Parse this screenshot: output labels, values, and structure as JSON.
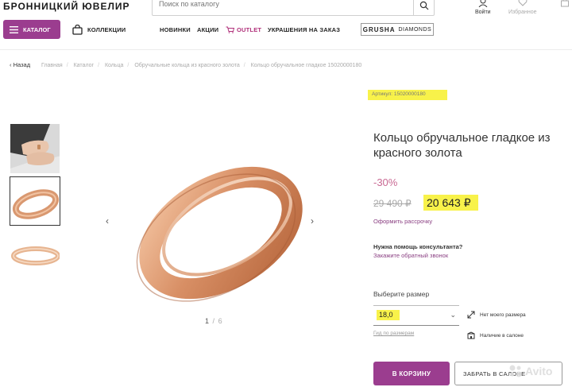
{
  "header": {
    "logo": "БРОННИЦКИЙ ЮВЕЛИР",
    "search_placeholder": "Поиск по каталогу",
    "login_label": "Войти",
    "favorites_label": "Избранное"
  },
  "nav": {
    "catalog": "КАТАЛОГ",
    "collections": "КОЛЛЕКЦИИ",
    "items": [
      "НОВИНКИ",
      "АКЦИИ",
      "OUTLET",
      "УКРАШЕНИЯ НА ЗАКАЗ"
    ],
    "grusha_brand": "GRUSHA",
    "grusha_sub": "DIAMONDS"
  },
  "breadcrumbs": {
    "back": "Назад",
    "items": [
      "Главная",
      "Каталог",
      "Кольца",
      "Обручальные кольца из красного золота",
      "Кольцо обручальное гладкое 15020000180"
    ]
  },
  "gallery": {
    "current": "1",
    "separator": "/",
    "total": "6"
  },
  "product": {
    "sku": "Артикул: 15020000180",
    "title": "Кольцо обручальное гладкое из красного золота",
    "discount": "-30%",
    "old_price": "29 490 ₽",
    "new_price": "20 643 ₽",
    "installment": "Оформить рассрочку",
    "help_question": "Нужна помощь консультанта?",
    "callback": "Закажите обратный звонок",
    "size_label": "Выберите размер",
    "size_value": "18,0",
    "size_guide": "Гид по размерам",
    "no_size": "Нет моего размера",
    "in_store": "Наличие в салоне",
    "add_to_cart": "В КОРЗИНУ",
    "pickup": "ЗАБРАТЬ В САЛОНЕ"
  },
  "watermark": "Avito",
  "colors": {
    "brand_purple": "#9b3d8f",
    "highlight_yellow": "#f8f24a",
    "discount_pink": "#c96a94",
    "gold": "#d99870"
  }
}
